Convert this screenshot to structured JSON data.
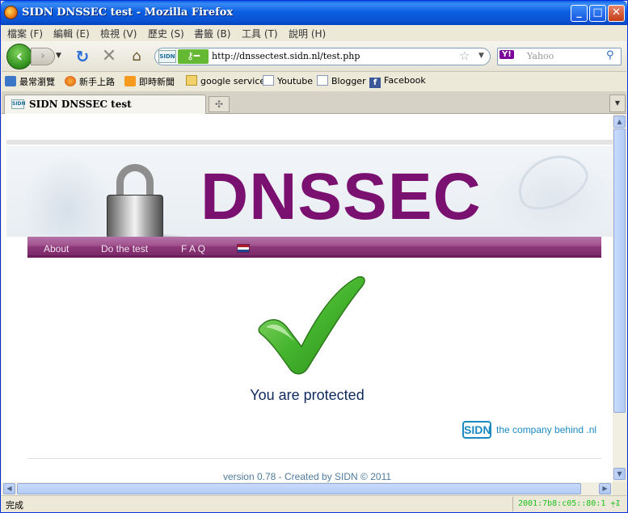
{
  "window": {
    "title": "SIDN DNSSEC test - Mozilla Firefox"
  },
  "menu": [
    "檔案 (F)",
    "編輯 (E)",
    "檢視 (V)",
    "歷史 (S)",
    "書籤 (B)",
    "工具 (T)",
    "說明 (H)"
  ],
  "toolbar": {
    "url": "http://dnssectest.sidn.nl/test.php",
    "site_badge": "SIDN",
    "search_placeholder": "Yahoo",
    "search_engine": "Y!"
  },
  "bookmarks": [
    "最常瀏覽",
    "新手上路",
    "即時新聞",
    "google service",
    "Youtube",
    "Blogger",
    "Facebook"
  ],
  "tabs": [
    {
      "label": "SIDN DNSSEC test",
      "active": true
    }
  ],
  "page": {
    "banner_title": "DNSSEC",
    "nav": [
      "About",
      "Do the test",
      "F A Q"
    ],
    "result": "You are protected",
    "sidn_logo": "SIDN",
    "sidn_tagline": "the company behind .nl",
    "footer": "version 0.78 - Created by SIDN © 2011"
  },
  "status": {
    "text": "完成",
    "ip": "2001:7b8:c05::80:1 +1"
  },
  "colors": {
    "brand_purple": "#7a1170",
    "nav_purple": "#8c3779",
    "check_green": "#3fae2a",
    "sidn_blue": "#1c8ac0",
    "result_text": "#0e2a5c"
  }
}
